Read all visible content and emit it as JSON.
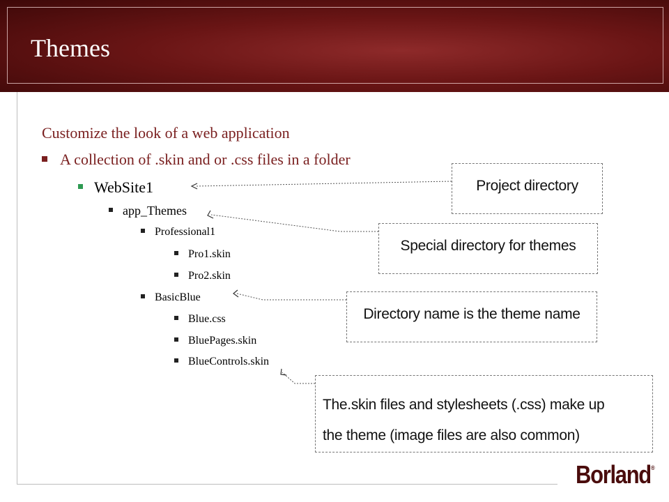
{
  "slide": {
    "title": "Themes",
    "bullets": [
      {
        "text": "Customize the look of a web application"
      },
      {
        "text": "A collection of .skin and or .css files in a folder"
      },
      {
        "text": "WebSite1"
      },
      {
        "text": "app_Themes"
      },
      {
        "text": "Professional1"
      },
      {
        "text": "Pro1.skin"
      },
      {
        "text": "Pro2.skin"
      },
      {
        "text": "BasicBlue"
      },
      {
        "text": "Blue.css"
      },
      {
        "text": "BluePages.skin"
      },
      {
        "text": "BlueControls.skin"
      }
    ],
    "callouts": {
      "project": "Project directory",
      "special": "Special directory for themes",
      "directory": "Directory name is the theme name",
      "skin_line1": "The.skin files and stylesheets (.css) make up",
      "skin_line2": "the theme (image files are also common)"
    },
    "logo": {
      "text": "Borland",
      "mark": "®"
    },
    "colors": {
      "header": "#6a1515",
      "accent": "#7a2020",
      "level2_bullet": "#2e9a52"
    }
  }
}
